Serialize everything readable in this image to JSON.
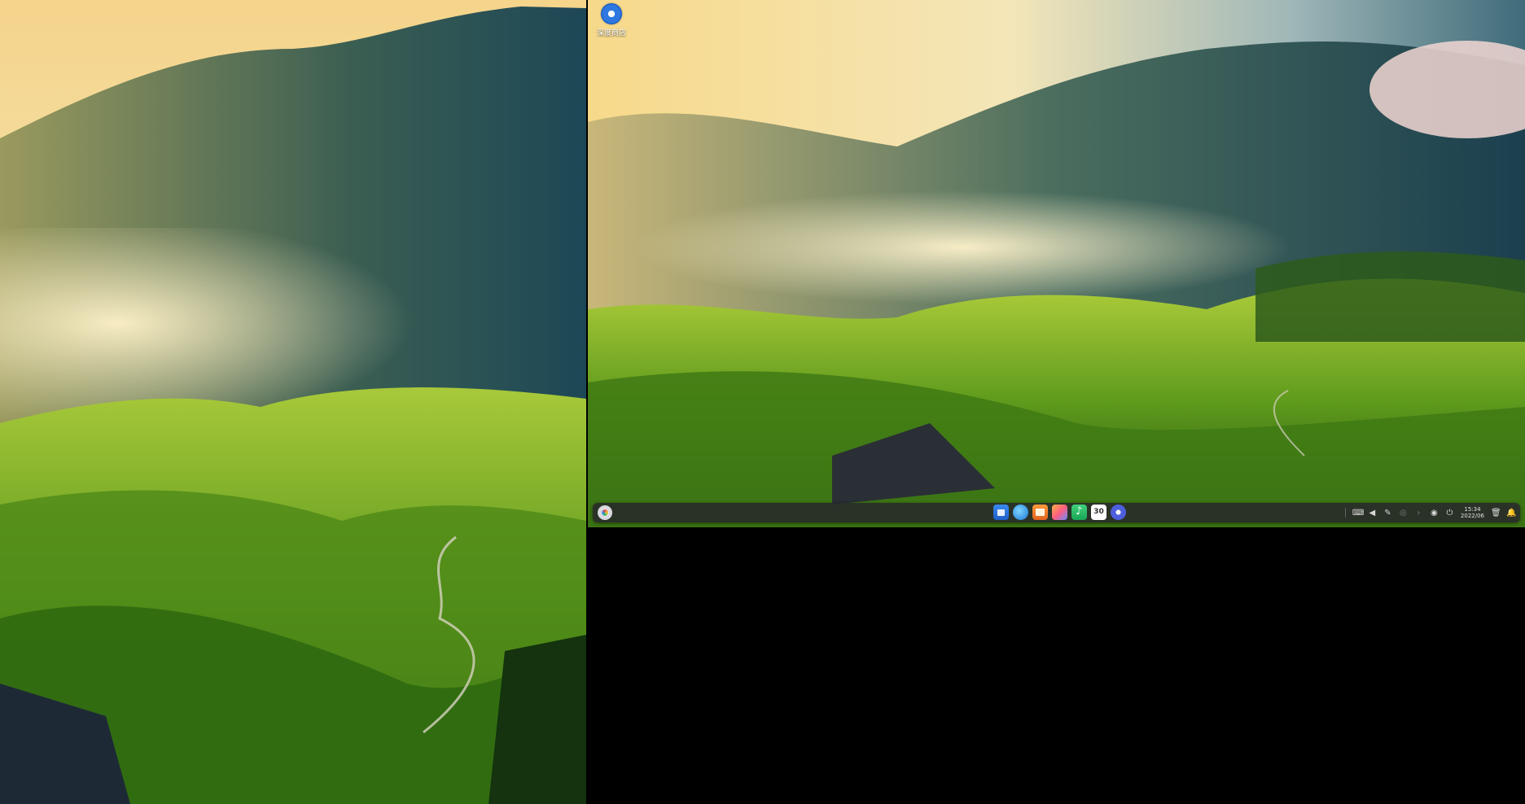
{
  "desktop": {
    "icon_label": "深度商店"
  },
  "taskbar": {
    "launcher_icon": "launcher-icon",
    "dock_apps": [
      {
        "name": "app-store",
        "icon": "store-icon"
      },
      {
        "name": "browser",
        "icon": "browser-icon"
      },
      {
        "name": "file-manager",
        "icon": "folder-icon"
      },
      {
        "name": "album",
        "icon": "image-icon"
      },
      {
        "name": "music",
        "icon": "music-icon"
      },
      {
        "name": "calendar",
        "icon": "calendar-icon",
        "text": "30"
      },
      {
        "name": "control-center",
        "icon": "gear-icon"
      }
    ],
    "clock_time": "15:34",
    "clock_date": "2022/06"
  },
  "colors": {
    "taskbar_bg": "#28282c",
    "sky_warm": "#f7d98a",
    "mountain_blue": "#1f4a5a",
    "terrace_green": "#5f9a1e"
  }
}
